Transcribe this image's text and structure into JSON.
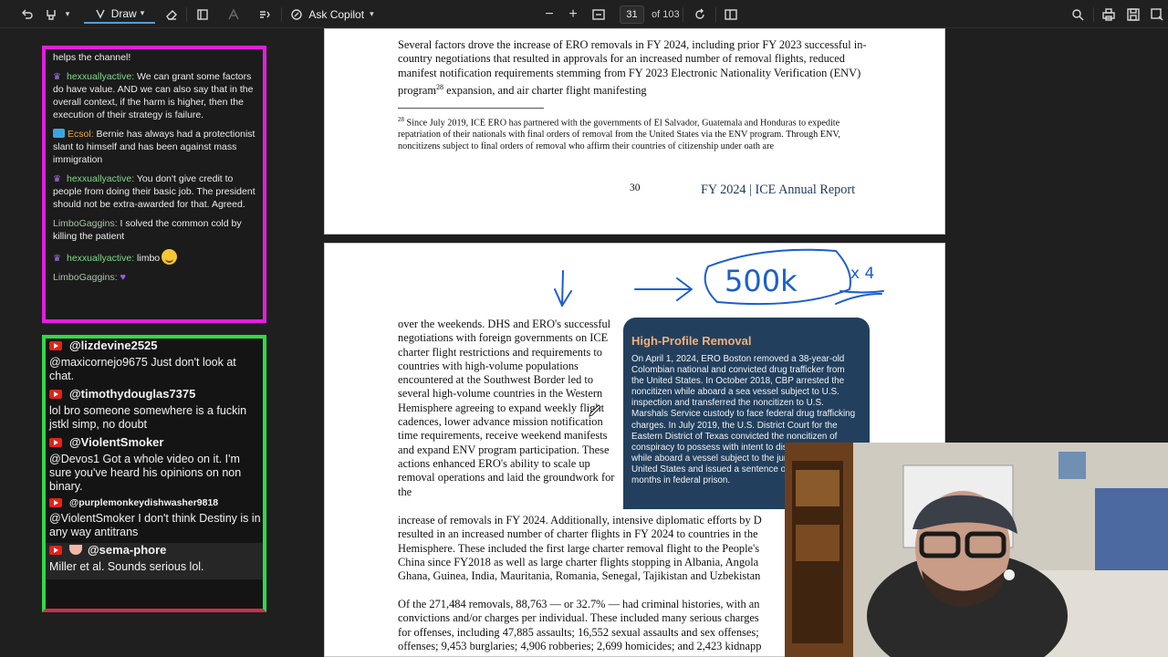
{
  "toolbar": {
    "draw_label": "Draw",
    "copilot_label": "Ask Copilot",
    "page_current": "31",
    "page_total": "of 103"
  },
  "chat_top": {
    "messages": [
      {
        "user": "",
        "text": "helps the channel!"
      },
      {
        "user": "hexxuallyactive:",
        "text": "We can grant some factors do have value. AND we can also say that in the overall context, if the harm is higher, then the execution of their strategy is failure."
      },
      {
        "user": "Ecsol:",
        "text": "Bernie has always had a protectionist slant to himself and has been against mass immigration"
      },
      {
        "user": "hexxuallyactive:",
        "text": "You don't give credit to people from doing their basic job. The president should not be extra-awarded for that. Agreed."
      },
      {
        "user": "LimboGaggins:",
        "text": "I solved the common cold by killing the patient"
      },
      {
        "user": "hexxuallyactive:",
        "text": "limbo"
      },
      {
        "user": "LimboGaggins:",
        "text": ""
      }
    ]
  },
  "chat_yt": {
    "messages": [
      {
        "user": "@lizdevine2525",
        "text": ""
      },
      {
        "user": "",
        "text": "@maxicornejo9675 Just don't look at chat."
      },
      {
        "user": "@timothydouglas7375",
        "text": "lol bro someone somewhere is a fuckin jstkl simp, no doubt"
      },
      {
        "user": "@ViolentSmoker",
        "text": "@Devos1 Got a whole video on it. I'm sure you've heard his opinions on non binary."
      },
      {
        "user": "@purplemonkeydishwasher9818",
        "text": "@ViolentSmoker I don't think Destiny is in any way antitrans"
      },
      {
        "user": "@sema-phore",
        "text": "Miller et al. Sounds serious lol."
      }
    ]
  },
  "doc": {
    "page1_para": "Several factors drove the increase of ERO removals in FY 2024, including prior FY 2023 successful in-country negotiations that resulted in approvals for an increased number of removal flights, reduced manifest notification requirements stemming from FY 2023 Electronic Nationality Verification (ENV) program",
    "page1_para_sup": "28",
    "page1_para_end": " expansion, and air charter flight manifesting",
    "footnote_num": "28",
    "footnote": " Since July 2019, ICE ERO has partnered with the governments of El Salvador, Guatemala and Honduras to expedite repatriation of their nationals with final orders of removal from the United States via the ENV program. Through ENV, noncitizens subject to final orders of removal who affirm their countries of citizenship under oath are",
    "page_number": "30",
    "report_title": "FY 2024 | ICE Annual Report",
    "col_text": "over the weekends. DHS and ERO's successful negotiations with foreign governments on ICE charter flight restrictions and requirements to countries with high-volume populations encountered at the Southwest Border led to several high-volume countries in the Western Hemisphere agreeing to expand weekly flight cadences, lower advance mission notification time requirements, receive weekend manifests and expand ENV program participation. These actions enhanced ERO's ability to scale up removal operations and laid the groundwork for the",
    "full_lines": [
      "increase of removals in FY 2024. Additionally, intensive diplomatic efforts by D",
      "resulted in an increased number of charter flights in FY 2024 to countries in the",
      "Hemisphere. These included the first large charter removal flight to the People's",
      "China since FY2018 as well as large charter flights stopping in Albania, Angola",
      "Ghana, Guinea, India, Mauritania, Romania, Senegal, Tajikistan and Uzbekistan"
    ],
    "full2_lines": [
      "Of the 271,484 removals, 88,763 — or 32.7% — had criminal histories, with an",
      "convictions and/or charges per individual. These included many serious charges",
      "for offenses, including 47,885 assaults; 16,552 sexual assaults and sex offenses;",
      "offenses; 9,453 burglaries; 4,906 robberies; 2,699 homicides; and 2,423 kidnapp"
    ],
    "box_title": "High-Profile Removal",
    "box_text": "On April 1, 2024, ERO Boston removed a 38-year-old Colombian national and convicted drug trafficker from the United States. In October 2018, CBP arrested the noncitizen while aboard a sea vessel subject to U.S. inspection and transferred the noncitizen to U.S. Marshals Service custody to face federal drug trafficking charges. In July 2019, the U.S. District Court for the Eastern District of Texas convicted the noncitizen of conspiracy to possess with intent to distribute cocaine while aboard a vessel subject to the jurisdiction of the United States and issued a sentence of 11 years and months in federal prison."
  },
  "annotation": {
    "big_text": "500k",
    "small_text": "x 4"
  }
}
